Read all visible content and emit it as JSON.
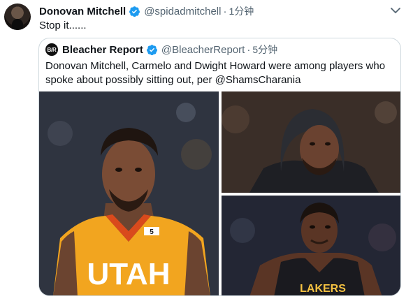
{
  "tweet": {
    "author_name": "Donovan Mitchell",
    "handle": "@spidadmitchell",
    "separator": "·",
    "time": "1分钟",
    "text": "Stop it......",
    "icons": {
      "verified": "verified-badge-icon",
      "more": "chevron-down-icon"
    }
  },
  "quoted": {
    "avatar_text": "B/R",
    "author_name": "Bleacher Report",
    "handle": "@BleacherReport",
    "separator": "·",
    "time": "5分钟",
    "text": "Donovan Mitchell, Carmelo and Dwight Howard were among players who spoke about possibly sitting out, per @ShamsCharania",
    "media": {
      "jersey_text": "UTAH",
      "jersey_patch": "5",
      "lakers_text": "LAKERS"
    }
  },
  "colors": {
    "text_primary": "#0f1419",
    "text_secondary": "#536471",
    "verified_blue": "#1d9bf0",
    "border": "#cfd9de"
  }
}
